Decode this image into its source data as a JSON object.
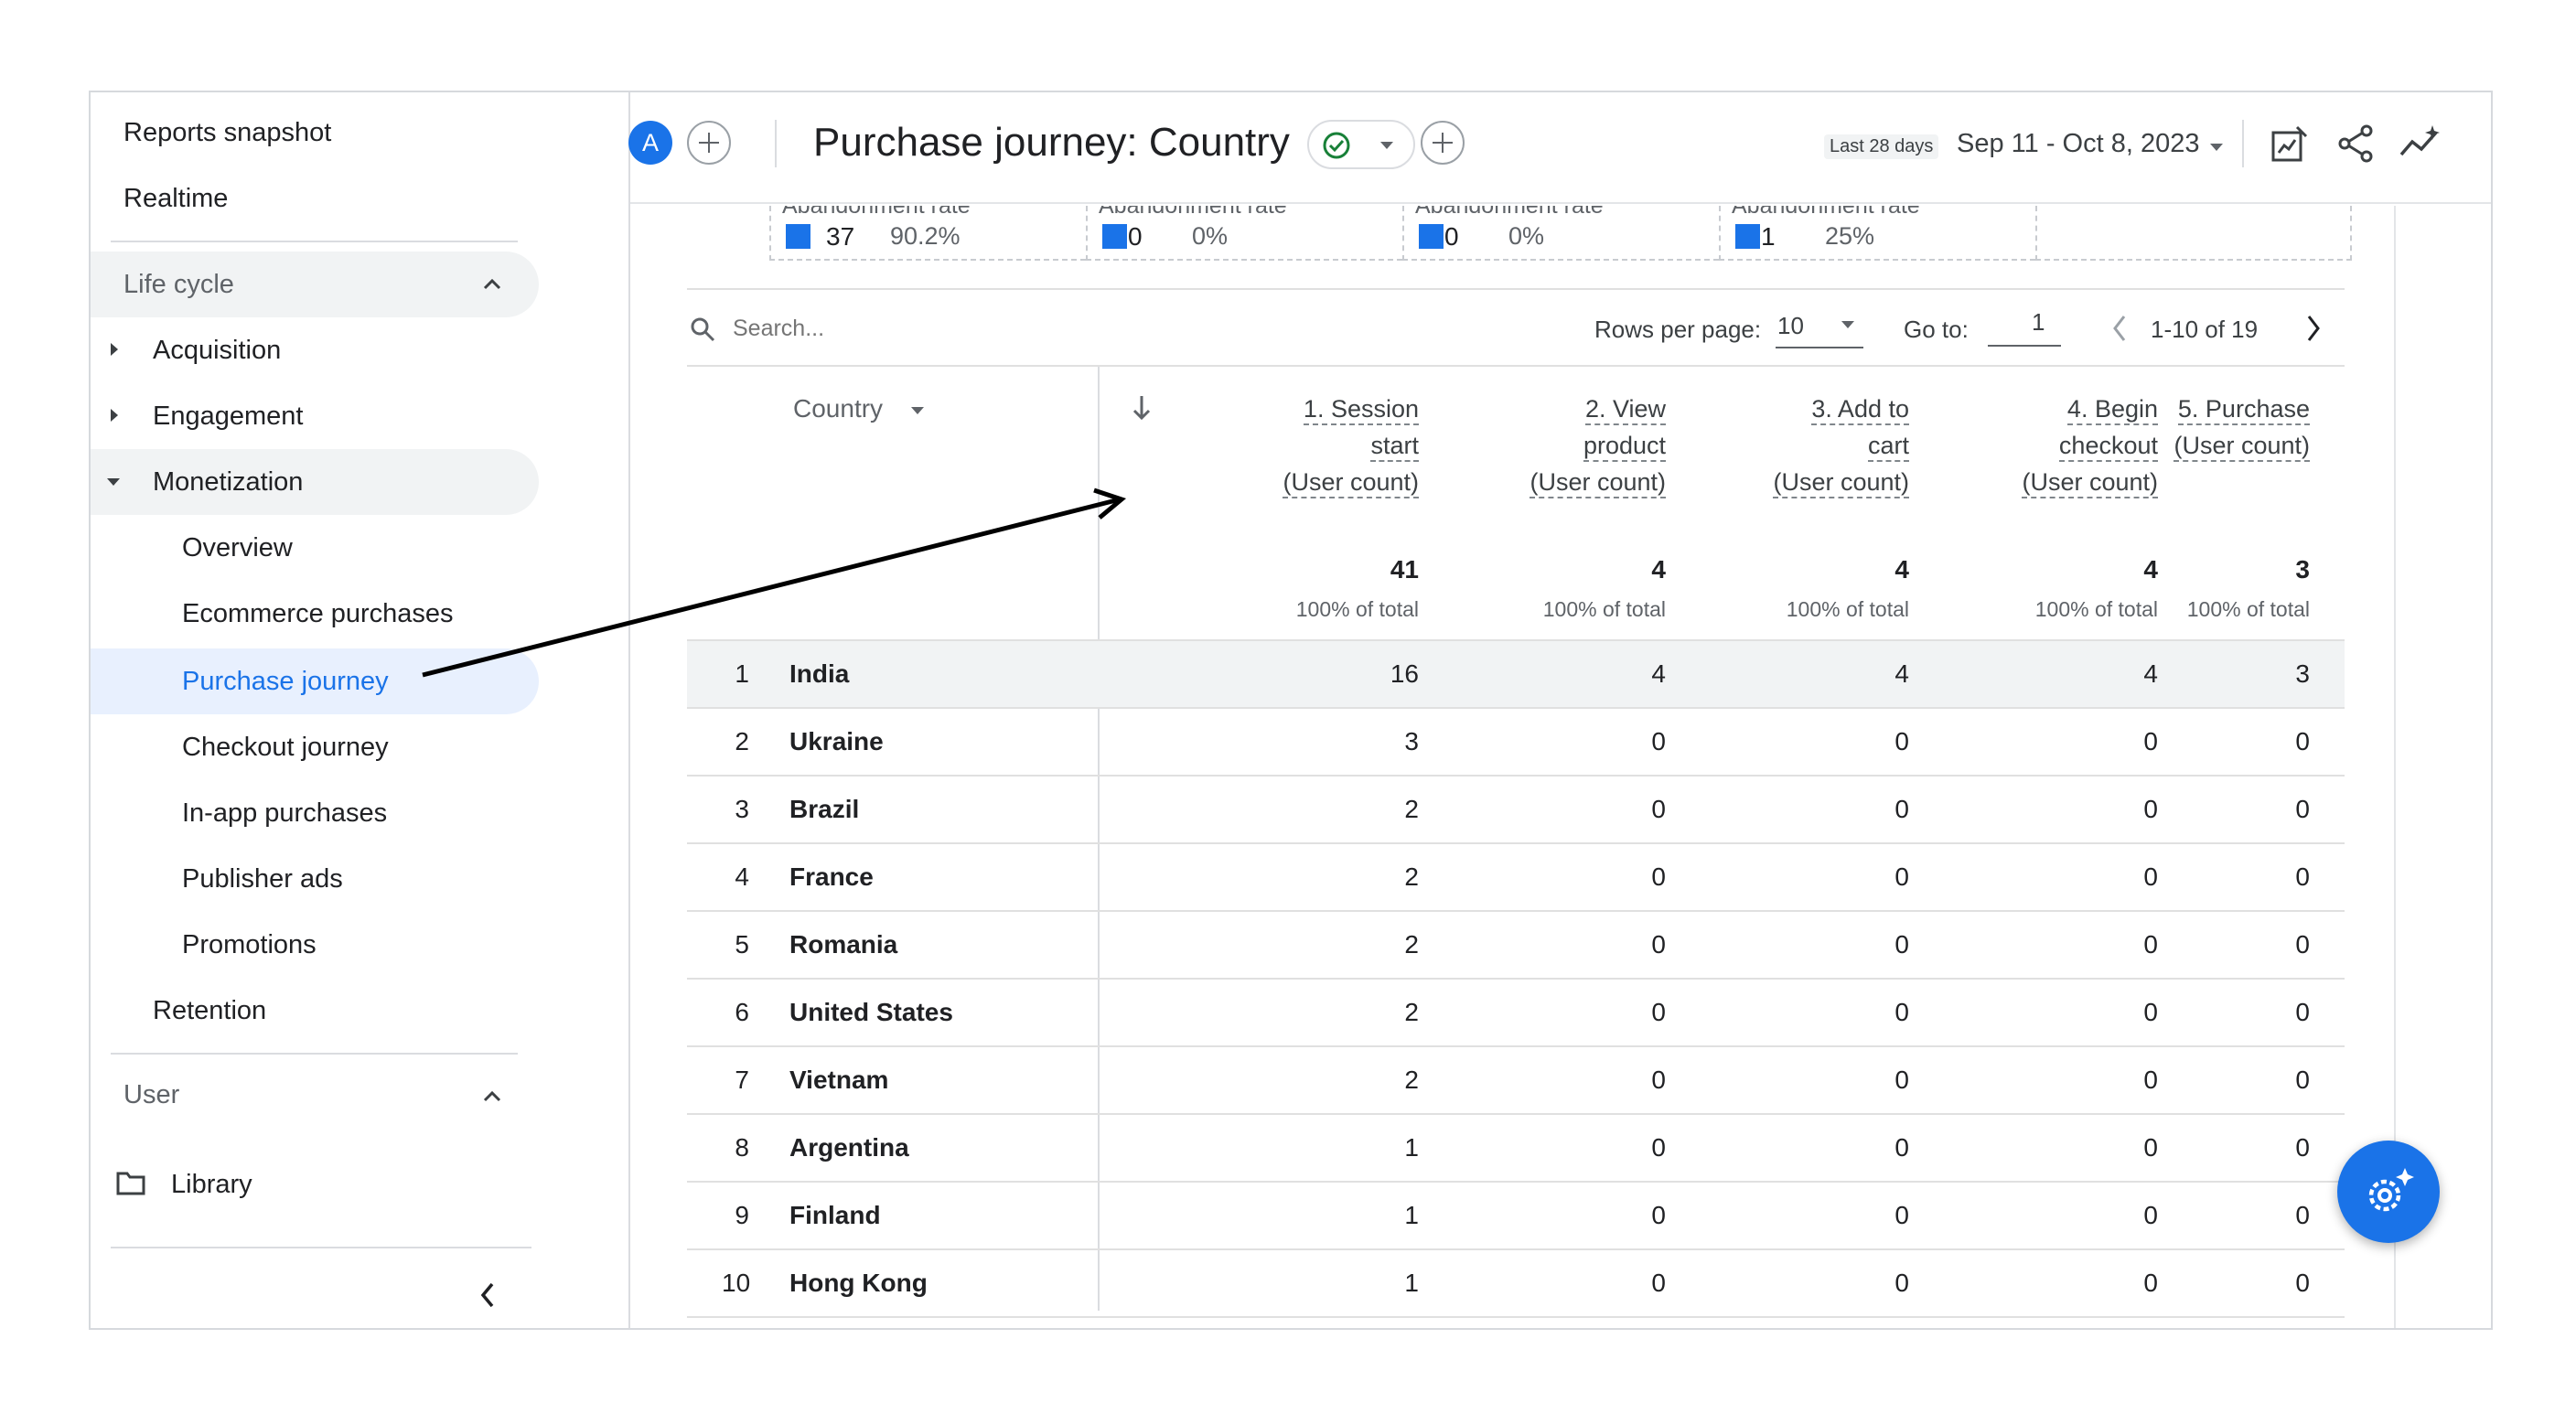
{
  "sidebar": {
    "reports_snapshot": "Reports snapshot",
    "realtime": "Realtime",
    "lifecycle": "Life cycle",
    "acquisition": "Acquisition",
    "engagement": "Engagement",
    "monetization": "Monetization",
    "sub_items": [
      "Overview",
      "Ecommerce purchases",
      "Purchase journey",
      "Checkout journey",
      "In-app purchases",
      "Publisher ads",
      "Promotions"
    ],
    "retention": "Retention",
    "user": "User",
    "library": "Library"
  },
  "header": {
    "avatar_letter": "A",
    "title": "Purchase journey: Country",
    "date_label": "Last 28 days",
    "date_range": "Sep 11 - Oct 8, 2023"
  },
  "abandonment": {
    "label": "Abandonment rate",
    "cells": [
      {
        "value": "37",
        "pct": "90.2%"
      },
      {
        "value": "0",
        "pct": "0%"
      },
      {
        "value": "0",
        "pct": "0%"
      },
      {
        "value": "1",
        "pct": "25%"
      }
    ]
  },
  "toolbar": {
    "search_placeholder": "Search...",
    "rows_per_page_label": "Rows per page:",
    "rows_per_page_value": "10",
    "goto_label": "Go to:",
    "goto_value": "1",
    "pagination": "1-10 of 19"
  },
  "table": {
    "dimension_header": "Country",
    "metric_headers": [
      {
        "line1": "1. Session",
        "line2": "start",
        "line3": "(User count)",
        "total": "41",
        "pct": "100% of total"
      },
      {
        "line1": "2. View",
        "line2": "product",
        "line3": "(User count)",
        "total": "4",
        "pct": "100% of total"
      },
      {
        "line1": "3. Add to",
        "line2": "cart",
        "line3": "(User count)",
        "total": "4",
        "pct": "100% of total"
      },
      {
        "line1": "4. Begin",
        "line2": "checkout",
        "line3": "(User count)",
        "total": "4",
        "pct": "100% of total"
      },
      {
        "line1": "5. Purchase",
        "line2": "(User count)",
        "line3": "",
        "total": "3",
        "pct": "100% of total"
      }
    ],
    "rows": [
      {
        "idx": "1",
        "country": "India",
        "values": [
          "16",
          "4",
          "4",
          "4",
          "3"
        ]
      },
      {
        "idx": "2",
        "country": "Ukraine",
        "values": [
          "3",
          "0",
          "0",
          "0",
          "0"
        ]
      },
      {
        "idx": "3",
        "country": "Brazil",
        "values": [
          "2",
          "0",
          "0",
          "0",
          "0"
        ]
      },
      {
        "idx": "4",
        "country": "France",
        "values": [
          "2",
          "0",
          "0",
          "0",
          "0"
        ]
      },
      {
        "idx": "5",
        "country": "Romania",
        "values": [
          "2",
          "0",
          "0",
          "0",
          "0"
        ]
      },
      {
        "idx": "6",
        "country": "United States",
        "values": [
          "2",
          "0",
          "0",
          "0",
          "0"
        ]
      },
      {
        "idx": "7",
        "country": "Vietnam",
        "values": [
          "2",
          "0",
          "0",
          "0",
          "0"
        ]
      },
      {
        "idx": "8",
        "country": "Argentina",
        "values": [
          "1",
          "0",
          "0",
          "0",
          "0"
        ]
      },
      {
        "idx": "9",
        "country": "Finland",
        "values": [
          "1",
          "0",
          "0",
          "0",
          "0"
        ]
      },
      {
        "idx": "10",
        "country": "Hong Kong",
        "values": [
          "1",
          "0",
          "0",
          "0",
          "0"
        ]
      }
    ]
  },
  "colors": {
    "accent": "#1a73e8",
    "active_bg": "#e8f0fe",
    "status_green": "#188038"
  }
}
